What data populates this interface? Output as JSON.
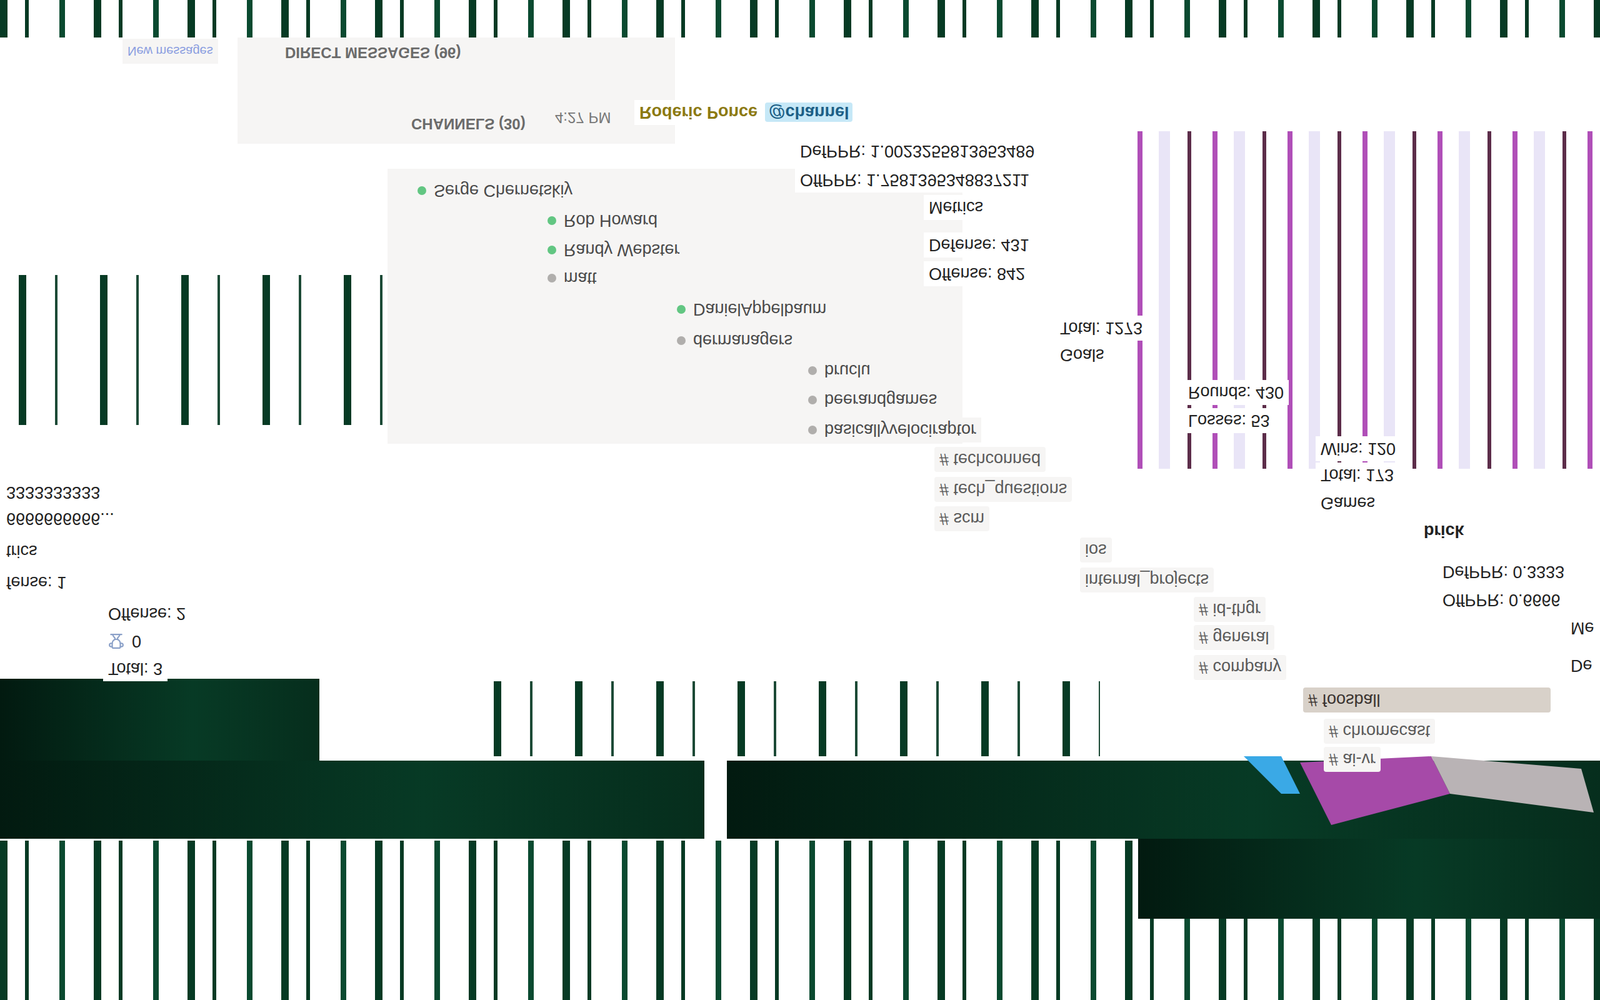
{
  "header": {
    "new_messages": "New messages",
    "direct_messages": "DIRECT MESSAGES (96)",
    "channels": "CHANNELS (30)",
    "time": "4:27 PM",
    "author": "Roderic Ponce",
    "mention": "@channel"
  },
  "direct_messages": [
    {
      "name": "Serge Chernetskiy",
      "online": true
    },
    {
      "name": "Rob Howard",
      "online": true
    },
    {
      "name": "Randy Webster",
      "online": true
    },
    {
      "name": "matt",
      "online": false
    },
    {
      "name": "DanielAppelbaum",
      "online": true
    },
    {
      "name": "dermanagers",
      "online": false
    },
    {
      "name": "bruclu",
      "online": false
    },
    {
      "name": "beerandgames",
      "online": false
    },
    {
      "name": "basicallyvelociraptor",
      "online": false
    }
  ],
  "channels": [
    {
      "name": "# techconned",
      "selected": false
    },
    {
      "name": "# tech_questions",
      "selected": false
    },
    {
      "name": "# scm",
      "selected": false
    },
    {
      "name": "ios",
      "selected": false
    },
    {
      "name": "internal_projects",
      "selected": false
    },
    {
      "name": "# id-thgr",
      "selected": false
    },
    {
      "name": "# general",
      "selected": false
    },
    {
      "name": "# company",
      "selected": false
    },
    {
      "name": "# foosball",
      "selected": true
    },
    {
      "name": "# chromecast",
      "selected": false
    },
    {
      "name": "# ai-vr",
      "selected": false
    }
  ],
  "player_stats": {
    "def_ppr": "DefPPR: 1.0023255813953489",
    "off_ppr": "OffPPR: 1.7581395348837211",
    "metrics_title": "Metrics",
    "defense": "Defense: 431",
    "offense": "Offense: 842",
    "goals_total": "Total: 1273",
    "goals_title": "Goals",
    "rounds": "Rounds: 430",
    "losses": "Losses: 53",
    "wins": "Wins: 120",
    "games_total": "Total: 173",
    "games_title": "Games"
  },
  "brick": {
    "name": "brick",
    "def_ppr": "DefPPR: 0.3333",
    "off_ppr": "OffPPR: 0.6666",
    "metrics_title": "Me",
    "defense": "De"
  },
  "small_stats": {
    "ppr_a": "3333333333",
    "ppr_b": "6666666666...",
    "metrics_title": "trics",
    "defense": "fense: 1",
    "offense": "Offense: 2",
    "trophies": "0",
    "total": "Total: 3"
  }
}
